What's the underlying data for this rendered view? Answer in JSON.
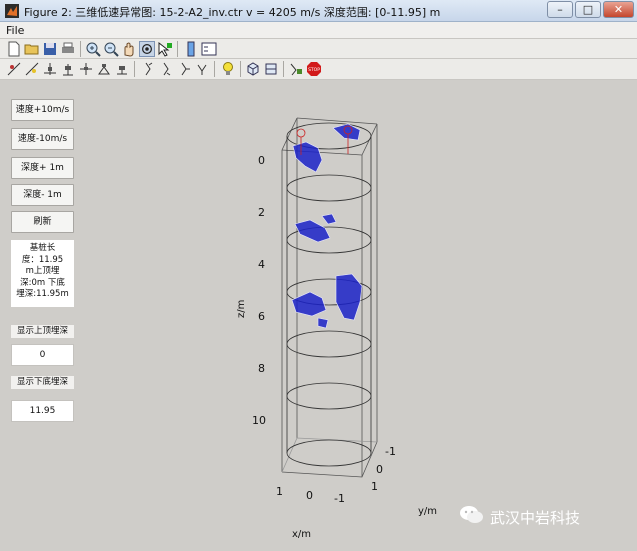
{
  "window": {
    "title": "Figure 2: 三维低速异常图: 15-2-A2_inv.ctr v = 4205 m/s 深度范围: [0-11.95] m",
    "minimize": "–",
    "maximize": "□",
    "close": "✕"
  },
  "menu": {
    "file": "File"
  },
  "controls": {
    "speed_up": "速度+10m/s",
    "speed_down": "速度-10m/s",
    "depth_up": "深度+ 1m",
    "depth_down": "深度- 1m",
    "refresh": "刷新"
  },
  "info": {
    "lines": [
      "基桩长",
      "度：11.95",
      "m上顶埋",
      "深:0m 下底",
      "埋深:11.95m"
    ]
  },
  "top_depth": {
    "label": "显示上顶埋深",
    "value": "0"
  },
  "bottom_depth": {
    "label": "显示下底埋深",
    "value": "11.95"
  },
  "chart_data": {
    "type": "3d-surface",
    "z_label": "z/m",
    "x_label": "x/m",
    "y_label": "y/m",
    "z_ticks": [
      "0",
      "2",
      "4",
      "6",
      "8",
      "10"
    ],
    "x_ticks": [
      "1",
      "0",
      "-1"
    ],
    "y_ticks": [
      "-1",
      "0",
      "1"
    ],
    "z_range": [
      0,
      11.95
    ],
    "anomaly_color": "#1b22c8",
    "anomalies_depth_m": [
      {
        "z_from": -0.3,
        "z_to": 0.6
      },
      {
        "z_from": 2.3,
        "z_to": 3.0
      },
      {
        "z_from": 4.6,
        "z_to": 6.4
      }
    ]
  },
  "watermark": {
    "text": "武汉中岩科技"
  },
  "toolbar": {
    "icons": [
      "new-file-icon",
      "open-folder-icon",
      "save-icon",
      "print-icon",
      "zoom-in-icon",
      "zoom-out-icon",
      "pan-icon",
      "rotate-3d-icon",
      "data-cursor-icon",
      "colorbar-icon",
      "legend-icon"
    ],
    "icons2": [
      "tool-a-icon",
      "tool-b-icon",
      "tool-c-icon",
      "tool-d-icon",
      "tool-e-icon",
      "tool-f-icon",
      "tool-g-icon",
      "tool-h-icon",
      "tool-i-icon",
      "tool-j-icon",
      "bulb-icon",
      "cube-icon",
      "cube-open-icon",
      "tool-k-icon",
      "stop-icon"
    ]
  }
}
